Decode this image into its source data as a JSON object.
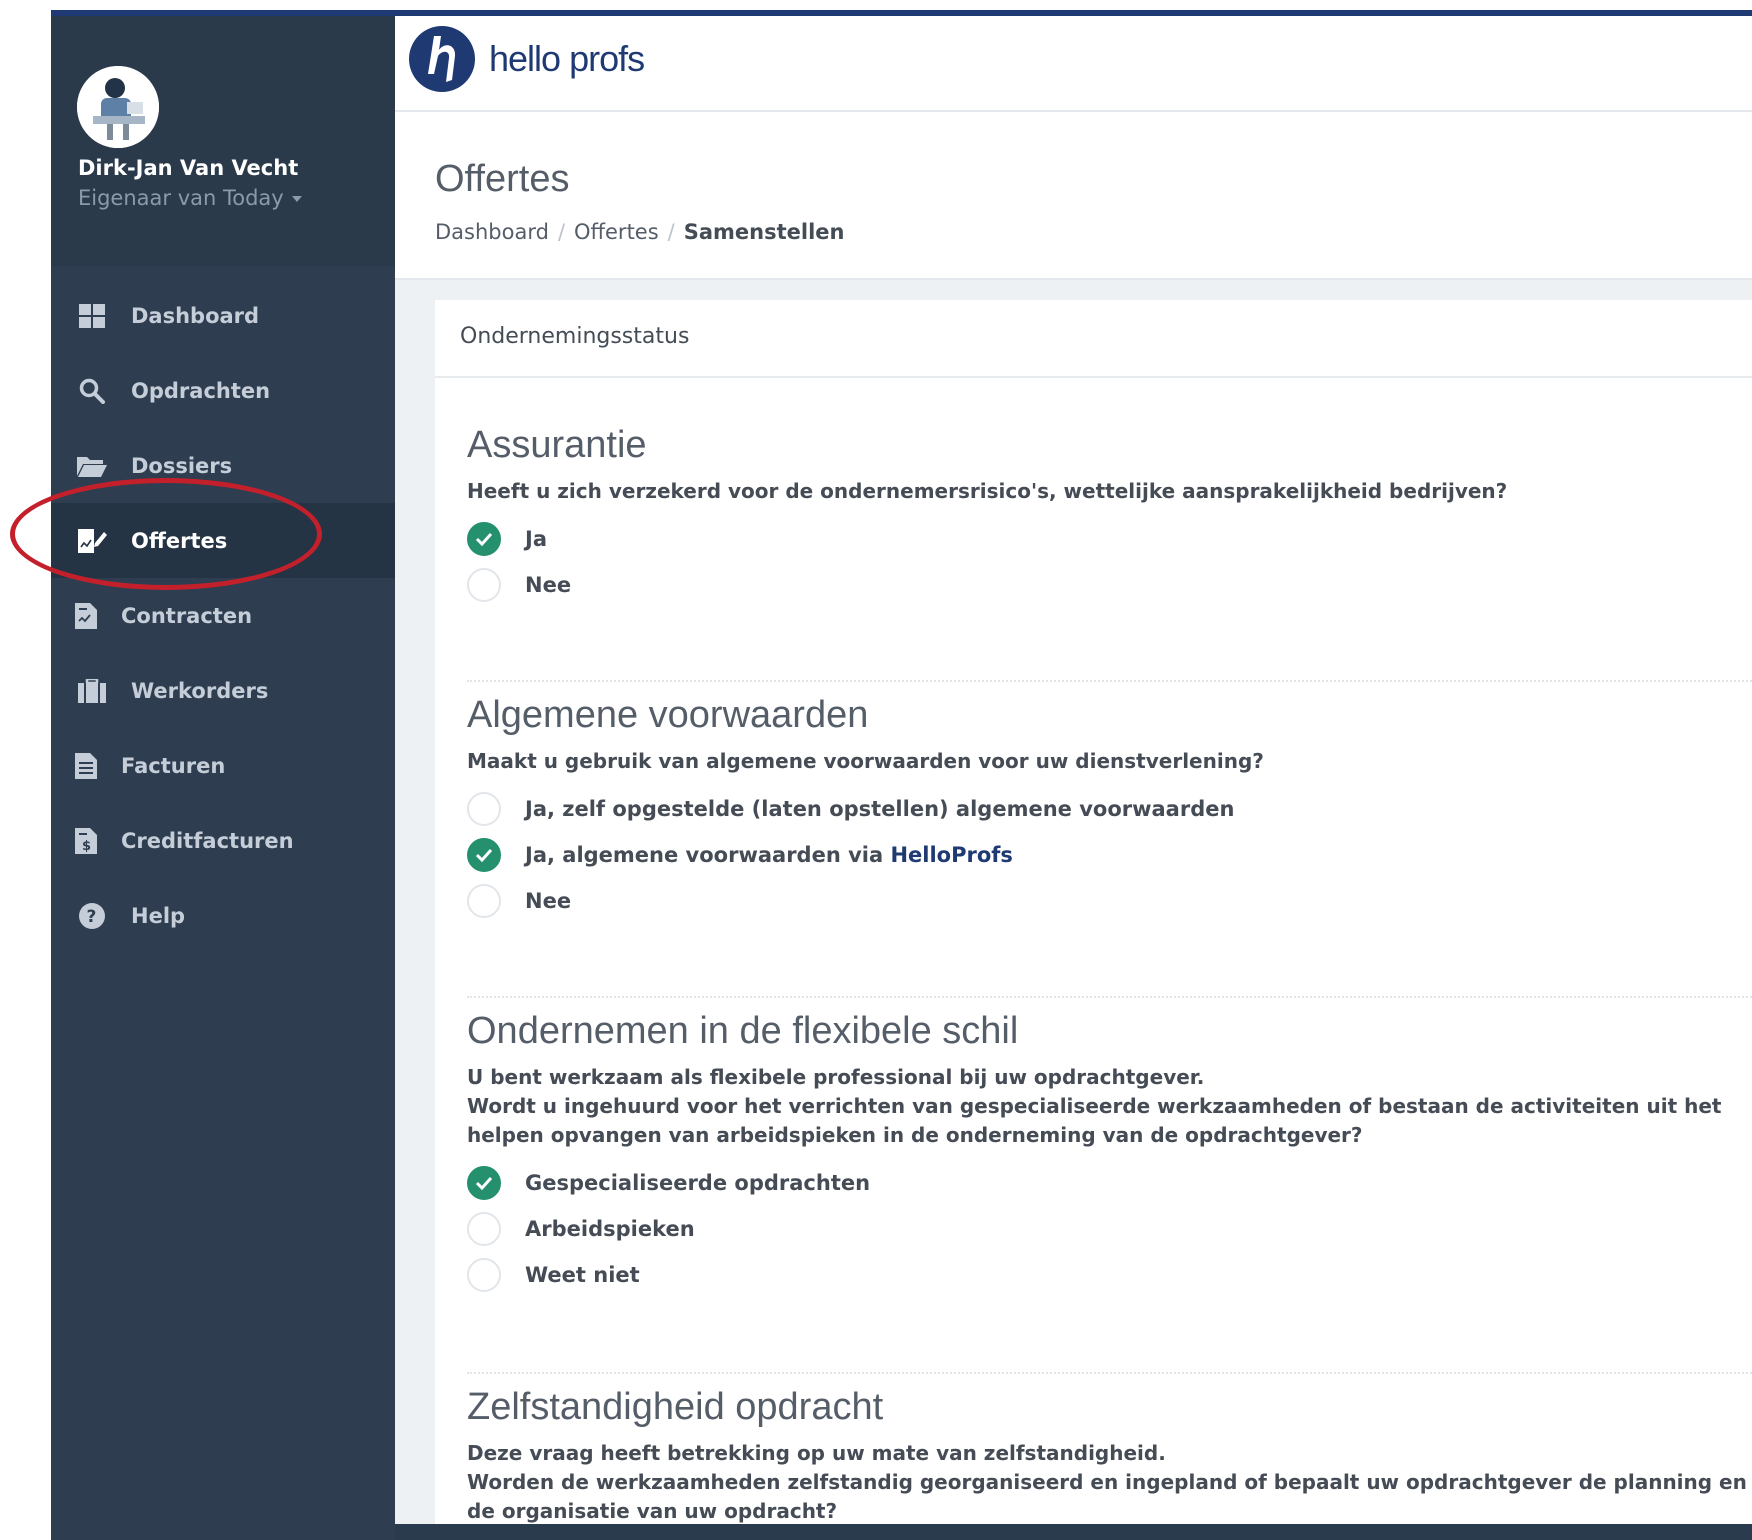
{
  "user": {
    "name": "Dirk-Jan Van Vecht",
    "role": "Eigenaar van Today"
  },
  "sidebar": {
    "items": [
      {
        "label": "Dashboard",
        "icon": "dashboard-icon"
      },
      {
        "label": "Opdrachten",
        "icon": "search-icon"
      },
      {
        "label": "Dossiers",
        "icon": "folder-icon"
      },
      {
        "label": "Offertes",
        "icon": "edit-document-icon",
        "active": true
      },
      {
        "label": "Contracten",
        "icon": "contract-icon"
      },
      {
        "label": "Werkorders",
        "icon": "briefcase-icon"
      },
      {
        "label": "Facturen",
        "icon": "invoice-icon"
      },
      {
        "label": "Creditfacturen",
        "icon": "credit-invoice-icon"
      },
      {
        "label": "Help",
        "icon": "help-icon"
      }
    ]
  },
  "brand": {
    "logo_text": "hello profs",
    "color": "#1f3a73"
  },
  "header": {
    "title": "Offertes",
    "breadcrumb": [
      "Dashboard",
      "Offertes",
      "Samenstellen"
    ]
  },
  "card": {
    "title": "Ondernemingsstatus"
  },
  "sections": [
    {
      "title": "Assurantie",
      "question": "Heeft u zich verzekerd voor de ondernemersrisico's, wettelijke aansprakelijkheid bedrijven?",
      "options": [
        {
          "label": "Ja",
          "checked": true
        },
        {
          "label": "Nee",
          "checked": false
        }
      ]
    },
    {
      "title": "Algemene voorwaarden",
      "question": "Maakt u gebruik van algemene voorwaarden voor uw dienstverlening?",
      "options": [
        {
          "label": "Ja, zelf opgestelde (laten opstellen) algemene voorwaarden",
          "checked": false
        },
        {
          "label": "Ja, algemene voorwaarden via ",
          "link": "HelloProfs",
          "checked": true
        },
        {
          "label": "Nee",
          "checked": false
        }
      ]
    },
    {
      "title": "Ondernemen in de flexibele schil",
      "question_lines": [
        "U bent werkzaam als flexibele professional bij uw opdrachtgever.",
        "Wordt u ingehuurd voor het verrichten van gespecialiseerde werkzaamheden of bestaan de activiteiten uit het helpen opvangen van arbeidspieken in de onderneming van de opdrachtgever?"
      ],
      "options": [
        {
          "label": "Gespecialiseerde opdrachten",
          "checked": true
        },
        {
          "label": "Arbeidspieken",
          "checked": false
        },
        {
          "label": "Weet niet",
          "checked": false
        }
      ]
    },
    {
      "title": "Zelfstandigheid opdracht",
      "question_lines": [
        "Deze vraag heeft betrekking op uw mate van zelfstandigheid.",
        "Worden de werkzaamheden zelfstandig georganiseerd en ingepland of bepaalt uw opdrachtgever de planning en de organisatie van uw opdracht?"
      ]
    }
  ],
  "colors": {
    "sidebar": "#2e3e50",
    "accent_green": "#25906e",
    "highlight_red": "#c4202b"
  }
}
